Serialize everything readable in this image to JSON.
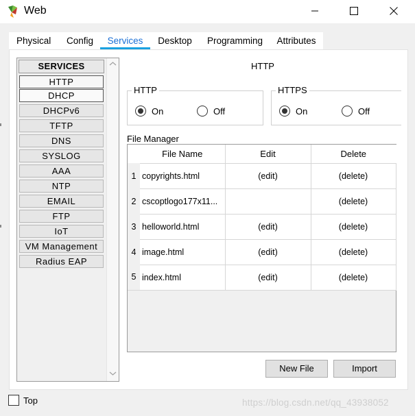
{
  "window": {
    "title": "Web",
    "icon": "packet-tracer-device-icon",
    "controls": [
      "minimize-icon",
      "maximize-icon",
      "close-icon"
    ]
  },
  "tabs": [
    {
      "label": "Physical",
      "active": false
    },
    {
      "label": "Config",
      "active": false
    },
    {
      "label": "Services",
      "active": true
    },
    {
      "label": "Desktop",
      "active": false
    },
    {
      "label": "Programming",
      "active": false
    },
    {
      "label": "Attributes",
      "active": false
    }
  ],
  "sidebar": {
    "header": "SERVICES",
    "items": [
      {
        "label": "HTTP",
        "selected": true
      },
      {
        "label": "DHCP",
        "selected": false
      },
      {
        "label": "DHCPv6",
        "selected": false
      },
      {
        "label": "TFTP",
        "selected": false
      },
      {
        "label": "DNS",
        "selected": false
      },
      {
        "label": "SYSLOG",
        "selected": false
      },
      {
        "label": "AAA",
        "selected": false
      },
      {
        "label": "NTP",
        "selected": false
      },
      {
        "label": "EMAIL",
        "selected": false
      },
      {
        "label": "FTP",
        "selected": false
      },
      {
        "label": "IoT",
        "selected": false
      },
      {
        "label": "VM Management",
        "selected": false
      },
      {
        "label": "Radius EAP",
        "selected": false
      }
    ]
  },
  "panel": {
    "title": "HTTP",
    "http": {
      "legend": "HTTP",
      "on_label": "On",
      "off_label": "Off",
      "value": "On"
    },
    "https": {
      "legend": "HTTPS",
      "on_label": "On",
      "off_label": "Off",
      "value": "On"
    }
  },
  "file_manager": {
    "label": "File Manager",
    "columns": [
      "File Name",
      "Edit",
      "Delete"
    ],
    "rows": [
      {
        "index": "1",
        "name": "copyrights.html",
        "edit": "(edit)",
        "delete": "(delete)"
      },
      {
        "index": "2",
        "name": "cscoptlogo177x11...",
        "edit": "",
        "delete": "(delete)"
      },
      {
        "index": "3",
        "name": "helloworld.html",
        "edit": "(edit)",
        "delete": "(delete)"
      },
      {
        "index": "4",
        "name": "image.html",
        "edit": "(edit)",
        "delete": "(delete)"
      },
      {
        "index": "5",
        "name": "index.html",
        "edit": "(edit)",
        "delete": "(delete)"
      }
    ],
    "new_file_label": "New File",
    "import_label": "Import"
  },
  "footer": {
    "top_label": "Top",
    "top_checked": false,
    "watermark": "https://blog.csdn.net/qq_43938052"
  }
}
